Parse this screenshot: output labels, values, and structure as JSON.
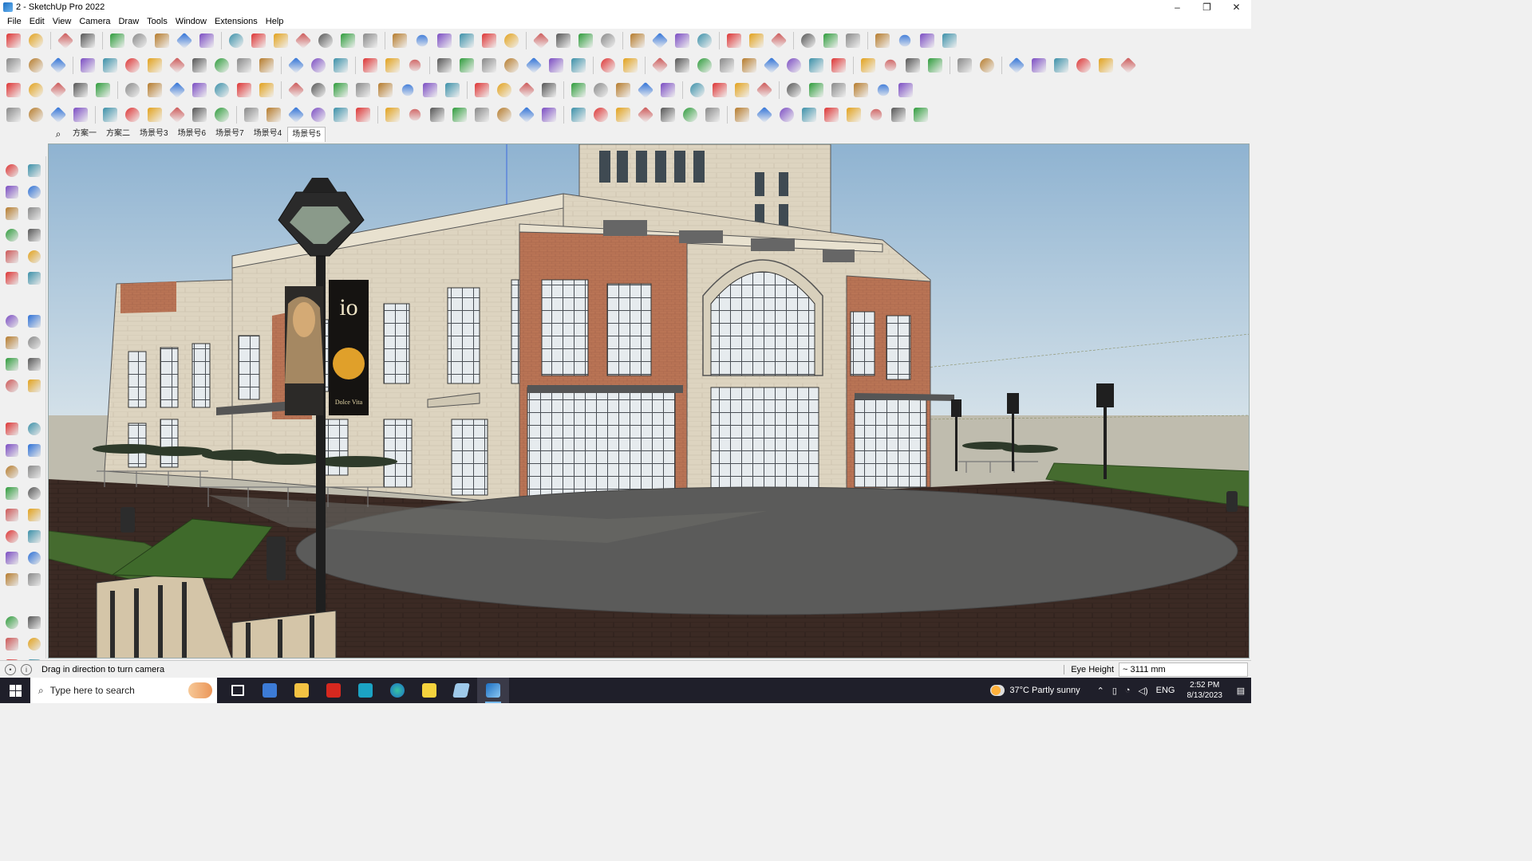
{
  "window": {
    "title": "2 - SketchUp Pro 2022",
    "controls": [
      "–",
      "❐",
      "✕"
    ]
  },
  "menu": [
    "File",
    "Edit",
    "View",
    "Camera",
    "Draw",
    "Tools",
    "Window",
    "Extensions",
    "Help"
  ],
  "scene_tabs": {
    "items": [
      "方案一",
      "方案二",
      "场景号3",
      "场景号6",
      "场景号7",
      "场景号4",
      "场景号5"
    ],
    "active": "场景号5"
  },
  "viewport": {
    "banner_text": "io",
    "banner_caption": "Dolce Vita"
  },
  "status": {
    "message": "Drag in direction to turn camera",
    "measure_label": "Eye Height",
    "measure_value": "~ 3111 mm"
  },
  "taskbar": {
    "search_placeholder": "Type here to search",
    "weather": "37°C  Partly sunny",
    "language": "ENG",
    "time": "2:52 PM",
    "date": "8/13/2023"
  },
  "colors": {
    "accent_blue": "#1b6fc2",
    "sky": "#aac6dc",
    "brick": "#b97455",
    "stone": "#ddd4c0"
  }
}
